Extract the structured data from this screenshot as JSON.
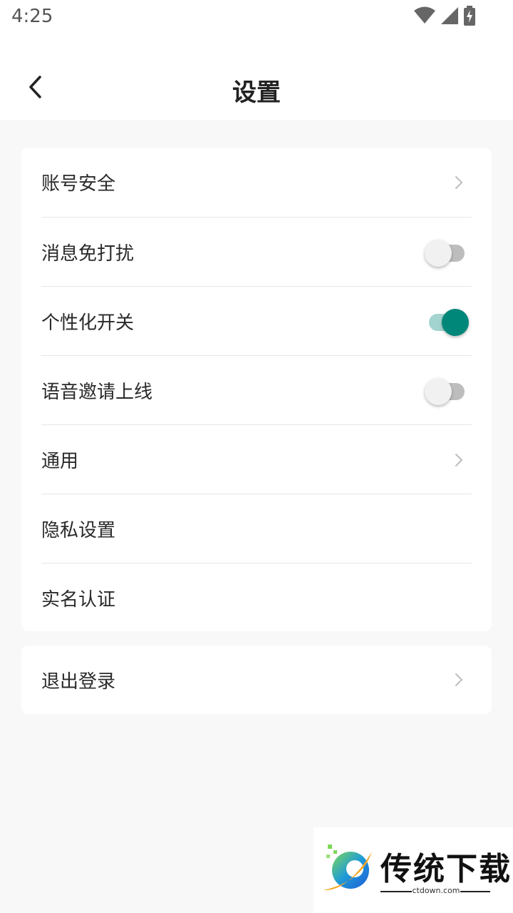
{
  "status_bar": {
    "time": "4:25",
    "icons": [
      "wifi-icon",
      "signal-icon",
      "battery-charging-icon"
    ]
  },
  "header": {
    "title": "设置",
    "back_icon": "chevron-left-icon"
  },
  "settings": {
    "items": [
      {
        "label": "账号安全",
        "control": "chevron"
      },
      {
        "label": "消息免打扰",
        "control": "toggle",
        "on": false
      },
      {
        "label": "个性化开关",
        "control": "toggle",
        "on": true
      },
      {
        "label": "语音邀请上线",
        "control": "toggle",
        "on": false
      },
      {
        "label": "通用",
        "control": "chevron"
      },
      {
        "label": "隐私设置",
        "control": "none"
      },
      {
        "label": "实名认证",
        "control": "none"
      }
    ],
    "logout_label": "退出登录"
  },
  "watermark": {
    "title": "传统下载",
    "subtitle": "ctdown.com"
  },
  "colors": {
    "accent": "#00877a",
    "accent_track": "#a3d4cf",
    "background": "#f8f8f8",
    "card": "#ffffff"
  }
}
